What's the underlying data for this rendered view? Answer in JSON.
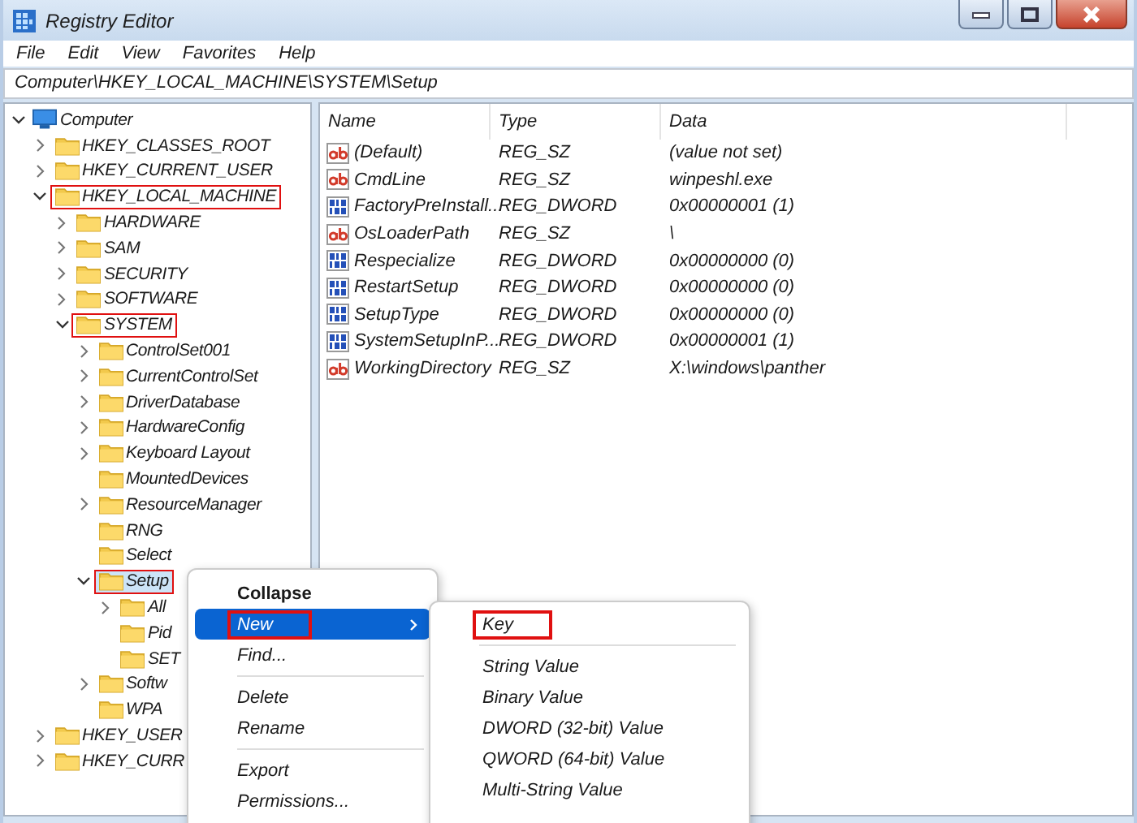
{
  "window": {
    "title": "Registry Editor"
  },
  "menu_bar": [
    "File",
    "Edit",
    "View",
    "Favorites",
    "Help"
  ],
  "address": "Computer\\HKEY_LOCAL_MACHINE\\SYSTEM\\Setup",
  "tree": {
    "items": [
      {
        "label": "Computer",
        "kind": "computer",
        "expanded": true,
        "selected": false,
        "highlighted": false,
        "children": [
          {
            "label": "HKEY_CLASSES_ROOT",
            "kind": "folder",
            "expanded": false,
            "selected": false,
            "highlighted": false
          },
          {
            "label": "HKEY_CURRENT_USER",
            "kind": "folder",
            "expanded": false,
            "selected": false,
            "highlighted": false
          },
          {
            "label": "HKEY_LOCAL_MACHINE",
            "kind": "folder",
            "expanded": true,
            "selected": false,
            "highlighted": true,
            "children": [
              {
                "label": "HARDWARE",
                "kind": "folder",
                "expanded": false,
                "selected": false,
                "highlighted": false
              },
              {
                "label": "SAM",
                "kind": "folder",
                "expanded": false,
                "selected": false,
                "highlighted": false
              },
              {
                "label": "SECURITY",
                "kind": "folder",
                "expanded": false,
                "selected": false,
                "highlighted": false
              },
              {
                "label": "SOFTWARE",
                "kind": "folder",
                "expanded": false,
                "selected": false,
                "highlighted": false
              },
              {
                "label": "SYSTEM",
                "kind": "folder",
                "expanded": true,
                "selected": false,
                "highlighted": true,
                "children": [
                  {
                    "label": "ControlSet001",
                    "kind": "folder",
                    "expanded": false,
                    "selected": false,
                    "highlighted": false
                  },
                  {
                    "label": "CurrentControlSet",
                    "kind": "folder",
                    "expanded": false,
                    "selected": false,
                    "highlighted": false
                  },
                  {
                    "label": "DriverDatabase",
                    "kind": "folder",
                    "expanded": false,
                    "selected": false,
                    "highlighted": false
                  },
                  {
                    "label": "HardwareConfig",
                    "kind": "folder",
                    "expanded": false,
                    "selected": false,
                    "highlighted": false
                  },
                  {
                    "label": "Keyboard Layout",
                    "kind": "folder",
                    "expanded": false,
                    "selected": false,
                    "highlighted": false
                  },
                  {
                    "label": "MountedDevices",
                    "kind": "folder",
                    "selected": false,
                    "highlighted": false
                  },
                  {
                    "label": "ResourceManager",
                    "kind": "folder",
                    "expanded": false,
                    "selected": false,
                    "highlighted": false
                  },
                  {
                    "label": "RNG",
                    "kind": "folder",
                    "selected": false,
                    "highlighted": false
                  },
                  {
                    "label": "Select",
                    "kind": "folder",
                    "selected": false,
                    "highlighted": false
                  },
                  {
                    "label": "Setup",
                    "kind": "folder",
                    "expanded": true,
                    "selected": true,
                    "highlighted": true,
                    "children": [
                      {
                        "label": "All",
                        "kind": "folder",
                        "expanded": false,
                        "selected": false,
                        "highlighted": false
                      },
                      {
                        "label": "Pid",
                        "kind": "folder",
                        "selected": false,
                        "highlighted": false
                      },
                      {
                        "label": "SET",
                        "kind": "folder",
                        "selected": false,
                        "highlighted": false
                      }
                    ]
                  },
                  {
                    "label": "Softw",
                    "kind": "folder",
                    "expanded": false,
                    "selected": false,
                    "highlighted": false
                  },
                  {
                    "label": "WPA",
                    "kind": "folder",
                    "selected": false,
                    "highlighted": false
                  }
                ]
              }
            ]
          },
          {
            "label": "HKEY_USER",
            "kind": "folder",
            "expanded": false,
            "selected": false,
            "highlighted": false
          },
          {
            "label": "HKEY_CURR",
            "kind": "folder",
            "expanded": false,
            "selected": false,
            "highlighted": false
          }
        ]
      }
    ]
  },
  "values": {
    "columns": [
      "Name",
      "Type",
      "Data"
    ],
    "rows": [
      {
        "kind": "string",
        "name": "(Default)",
        "type": "REG_SZ",
        "data": "(value not set)"
      },
      {
        "kind": "string",
        "name": "CmdLine",
        "type": "REG_SZ",
        "data": "winpeshl.exe"
      },
      {
        "kind": "binary",
        "name": "FactoryPreInstall...",
        "type": "REG_DWORD",
        "data": "0x00000001 (1)"
      },
      {
        "kind": "string",
        "name": "OsLoaderPath",
        "type": "REG_SZ",
        "data": "\\"
      },
      {
        "kind": "binary",
        "name": "Respecialize",
        "type": "REG_DWORD",
        "data": "0x00000000 (0)"
      },
      {
        "kind": "binary",
        "name": "RestartSetup",
        "type": "REG_DWORD",
        "data": "0x00000000 (0)"
      },
      {
        "kind": "binary",
        "name": "SetupType",
        "type": "REG_DWORD",
        "data": "0x00000000 (0)"
      },
      {
        "kind": "binary",
        "name": "SystemSetupInP...",
        "type": "REG_DWORD",
        "data": "0x00000001 (1)"
      },
      {
        "kind": "string",
        "name": "WorkingDirectory",
        "type": "REG_SZ",
        "data": "X:\\windows\\panther"
      }
    ]
  },
  "context_menu": {
    "groups": [
      [
        {
          "label": "Collapse",
          "bold": true,
          "submenu": false,
          "selected": false,
          "highlighted": false
        },
        {
          "label": "New",
          "bold": false,
          "submenu": true,
          "selected": true,
          "highlighted": true
        },
        {
          "label": "Find...",
          "bold": false,
          "submenu": false,
          "selected": false,
          "highlighted": false
        }
      ],
      [
        {
          "label": "Delete",
          "bold": false,
          "submenu": false,
          "selected": false,
          "highlighted": false
        },
        {
          "label": "Rename",
          "bold": false,
          "submenu": false,
          "selected": false,
          "highlighted": false
        }
      ],
      [
        {
          "label": "Export",
          "bold": false,
          "submenu": false,
          "selected": false,
          "highlighted": false
        },
        {
          "label": "Permissions...",
          "bold": false,
          "submenu": false,
          "selected": false,
          "highlighted": false
        }
      ]
    ]
  },
  "submenu": {
    "groups": [
      [
        {
          "label": "Key",
          "selected": false,
          "highlighted": true
        }
      ],
      [
        {
          "label": "String Value",
          "selected": false,
          "highlighted": false
        },
        {
          "label": "Binary Value",
          "selected": false,
          "highlighted": false
        },
        {
          "label": "DWORD (32-bit) Value",
          "selected": false,
          "highlighted": false
        },
        {
          "label": "QWORD (64-bit) Value",
          "selected": false,
          "highlighted": false
        },
        {
          "label": "Multi-String Value",
          "selected": false,
          "highlighted": false
        }
      ]
    ]
  }
}
